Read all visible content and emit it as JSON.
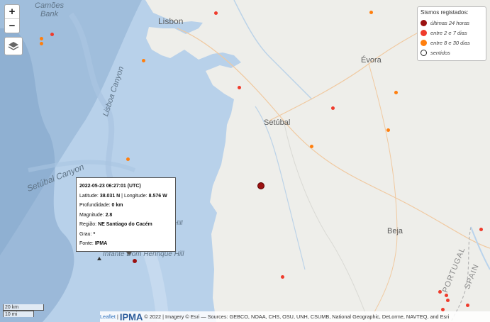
{
  "map": {
    "places": {
      "camoes_bank": "Camões\nBank",
      "lisbon": "Lisbon",
      "lisboa_canyon": "Lisboa Canyon",
      "setubal_canyon": "Setúbal Canyon",
      "setubal": "Setúbal",
      "evora": "Évora",
      "beja": "Beja",
      "infante": "Infante Dom Henrique Hill",
      "portugal": "PORTUGAL",
      "spain": "SPAIN",
      "hill_label": "Hill"
    }
  },
  "controls": {
    "zoom_in": "+",
    "zoom_out": "−",
    "layers_icon": "layers-icon"
  },
  "legend": {
    "title": "Sismos registados:",
    "items": [
      {
        "label": "últimas 24 horas",
        "color": "#9b1111"
      },
      {
        "label": "entre 2 e 7 dias",
        "color": "#ef3b2c"
      },
      {
        "label": "entre 8 e 30 dias",
        "color": "#ff7f0e"
      },
      {
        "label": "sentidos",
        "color": "#ffffff"
      }
    ]
  },
  "popup": {
    "datetime": "2022-05-23 06:27:01 (UTC)",
    "latitude_label": "Latitude:",
    "latitude": "38.031 N",
    "longitude_label": "Longitude:",
    "longitude": "8.576 W",
    "depth_label": "Profundidade:",
    "depth": "0 km",
    "magnitude_label": "Magnitude:",
    "magnitude": "2.8",
    "region_label": "Região:",
    "region": "NE Santiago do Cacém",
    "grau_label": "Grau:",
    "grau": "*",
    "source_label": "Fonte:",
    "source": "IPMA"
  },
  "scale": {
    "km": "20 km",
    "mi": "10 mi"
  },
  "attribution": {
    "leaflet": "Leaflet",
    "logo": "IPMA",
    "text": "© 2022 | Imagery © Esri — Sources: GEBCO, NOAA, CHS, OSU, UNH, CSUMB, National Geographic, DeLorme, NAVTEQ, and Esri"
  },
  "colors": {
    "sea": "#b9d3ec",
    "land": "#eeeeea",
    "quake_24h": "#9b1111",
    "quake_week": "#ef3b2c",
    "quake_month": "#ff7f0e"
  }
}
